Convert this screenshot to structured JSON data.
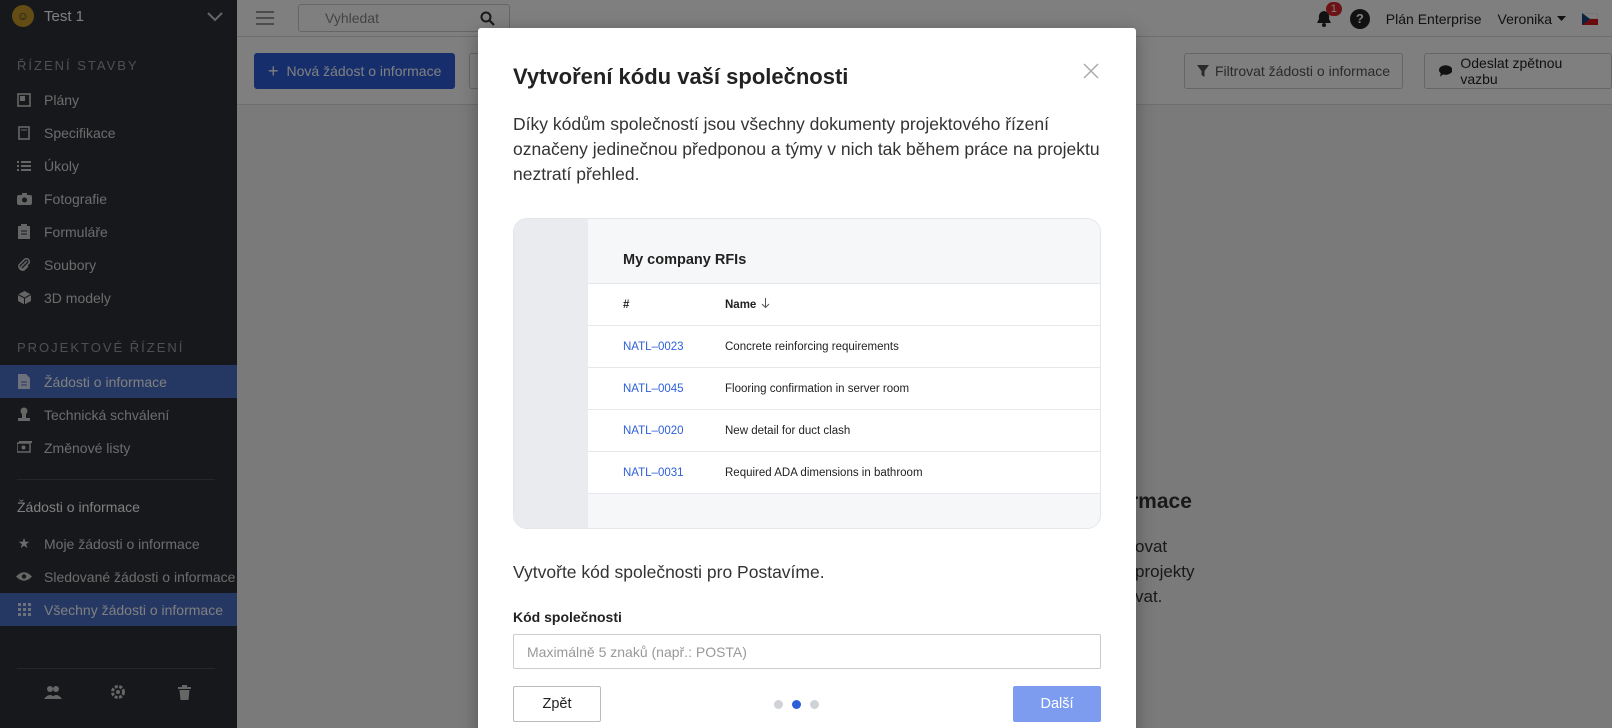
{
  "app": {
    "project_name": "Test 1",
    "search_placeholder": "Vyhledat",
    "notification_count": "1",
    "help_label": "?",
    "plan": "Plán Enterprise",
    "user": "Veronika"
  },
  "sidebar": {
    "section1_title": "ŘÍZENÍ STAVBY",
    "section1_items": [
      "Plány",
      "Specifikace",
      "Úkoly",
      "Fotografie",
      "Formuláře",
      "Soubory",
      "3D modely"
    ],
    "section2_title": "PROJEKTOVÉ ŘÍZENÍ",
    "section2_items": [
      "Žádosti o informace",
      "Technická schválení",
      "Změnové listy"
    ],
    "sub_heading": "Žádosti o informace",
    "sub_items": [
      "Moje žádosti o informace",
      "Sledované žádosti o informace",
      "Všechny žádosti o informace"
    ]
  },
  "toolbar": {
    "new_label": "Nová žádost o informace",
    "filter_label": "Filtrovat žádosti o informace",
    "feedback_label": "Odeslat zpětnou vazbu"
  },
  "background": {
    "title": "rmace",
    "text_lines": [
      "ovat",
      "projekty",
      "vat."
    ]
  },
  "modal": {
    "title": "Vytvoření kódu vaší společnosti",
    "description": "Díky kódům společností jsou všechny dokumenty projektového řízení označeny jedinečnou předponou a týmy v nich tak během práce na projektu neztratí přehled.",
    "preview": {
      "title": "My company RFIs",
      "col_number": "#",
      "col_name": "Name",
      "rows": [
        {
          "code": "NATL–0023",
          "name": "Concrete reinforcing requirements"
        },
        {
          "code": "NATL–0045",
          "name": "Flooring confirmation in server room"
        },
        {
          "code": "NATL–0020",
          "name": "New detail for duct clash"
        },
        {
          "code": "NATL–0031",
          "name": "Required ADA dimensions in bathroom"
        }
      ]
    },
    "prompt": "Vytvořte kód společnosti pro Postavíme.",
    "field_label": "Kód společnosti",
    "field_placeholder": "Maximálně 5 znaků (např.: POSTA)",
    "back_label": "Zpět",
    "next_label": "Další",
    "step_current": 2,
    "step_total": 3
  }
}
